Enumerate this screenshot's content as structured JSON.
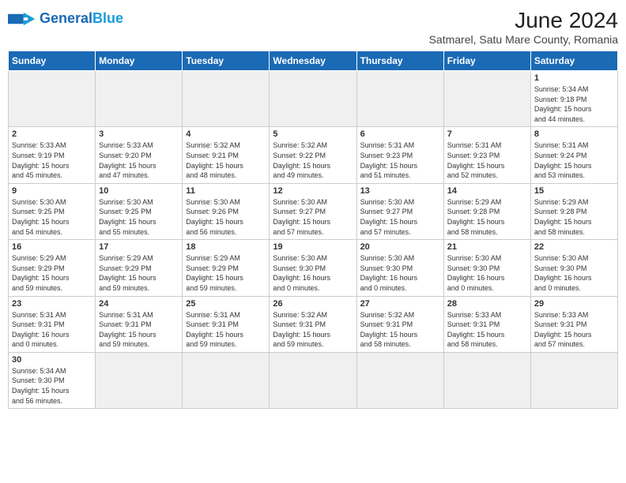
{
  "header": {
    "logo_general": "General",
    "logo_blue": "Blue",
    "month_title": "June 2024",
    "location": "Satmarel, Satu Mare County, Romania"
  },
  "weekdays": [
    "Sunday",
    "Monday",
    "Tuesday",
    "Wednesday",
    "Thursday",
    "Friday",
    "Saturday"
  ],
  "days": [
    {
      "date": null,
      "empty": true
    },
    {
      "date": null,
      "empty": true
    },
    {
      "date": null,
      "empty": true
    },
    {
      "date": null,
      "empty": true
    },
    {
      "date": null,
      "empty": true
    },
    {
      "date": null,
      "empty": true
    },
    {
      "date": "1",
      "info": "Sunrise: 5:34 AM\nSunset: 9:18 PM\nDaylight: 15 hours\nand 44 minutes."
    },
    {
      "date": "2",
      "info": "Sunrise: 5:33 AM\nSunset: 9:19 PM\nDaylight: 15 hours\nand 45 minutes."
    },
    {
      "date": "3",
      "info": "Sunrise: 5:33 AM\nSunset: 9:20 PM\nDaylight: 15 hours\nand 47 minutes."
    },
    {
      "date": "4",
      "info": "Sunrise: 5:32 AM\nSunset: 9:21 PM\nDaylight: 15 hours\nand 48 minutes."
    },
    {
      "date": "5",
      "info": "Sunrise: 5:32 AM\nSunset: 9:22 PM\nDaylight: 15 hours\nand 49 minutes."
    },
    {
      "date": "6",
      "info": "Sunrise: 5:31 AM\nSunset: 9:23 PM\nDaylight: 15 hours\nand 51 minutes."
    },
    {
      "date": "7",
      "info": "Sunrise: 5:31 AM\nSunset: 9:23 PM\nDaylight: 15 hours\nand 52 minutes."
    },
    {
      "date": "8",
      "info": "Sunrise: 5:31 AM\nSunset: 9:24 PM\nDaylight: 15 hours\nand 53 minutes."
    },
    {
      "date": "9",
      "info": "Sunrise: 5:30 AM\nSunset: 9:25 PM\nDaylight: 15 hours\nand 54 minutes."
    },
    {
      "date": "10",
      "info": "Sunrise: 5:30 AM\nSunset: 9:25 PM\nDaylight: 15 hours\nand 55 minutes."
    },
    {
      "date": "11",
      "info": "Sunrise: 5:30 AM\nSunset: 9:26 PM\nDaylight: 15 hours\nand 56 minutes."
    },
    {
      "date": "12",
      "info": "Sunrise: 5:30 AM\nSunset: 9:27 PM\nDaylight: 15 hours\nand 57 minutes."
    },
    {
      "date": "13",
      "info": "Sunrise: 5:30 AM\nSunset: 9:27 PM\nDaylight: 15 hours\nand 57 minutes."
    },
    {
      "date": "14",
      "info": "Sunrise: 5:29 AM\nSunset: 9:28 PM\nDaylight: 15 hours\nand 58 minutes."
    },
    {
      "date": "15",
      "info": "Sunrise: 5:29 AM\nSunset: 9:28 PM\nDaylight: 15 hours\nand 58 minutes."
    },
    {
      "date": "16",
      "info": "Sunrise: 5:29 AM\nSunset: 9:29 PM\nDaylight: 15 hours\nand 59 minutes."
    },
    {
      "date": "17",
      "info": "Sunrise: 5:29 AM\nSunset: 9:29 PM\nDaylight: 15 hours\nand 59 minutes."
    },
    {
      "date": "18",
      "info": "Sunrise: 5:29 AM\nSunset: 9:29 PM\nDaylight: 15 hours\nand 59 minutes."
    },
    {
      "date": "19",
      "info": "Sunrise: 5:30 AM\nSunset: 9:30 PM\nDaylight: 16 hours\nand 0 minutes."
    },
    {
      "date": "20",
      "info": "Sunrise: 5:30 AM\nSunset: 9:30 PM\nDaylight: 16 hours\nand 0 minutes."
    },
    {
      "date": "21",
      "info": "Sunrise: 5:30 AM\nSunset: 9:30 PM\nDaylight: 16 hours\nand 0 minutes."
    },
    {
      "date": "22",
      "info": "Sunrise: 5:30 AM\nSunset: 9:30 PM\nDaylight: 16 hours\nand 0 minutes."
    },
    {
      "date": "23",
      "info": "Sunrise: 5:31 AM\nSunset: 9:31 PM\nDaylight: 16 hours\nand 0 minutes."
    },
    {
      "date": "24",
      "info": "Sunrise: 5:31 AM\nSunset: 9:31 PM\nDaylight: 15 hours\nand 59 minutes."
    },
    {
      "date": "25",
      "info": "Sunrise: 5:31 AM\nSunset: 9:31 PM\nDaylight: 15 hours\nand 59 minutes."
    },
    {
      "date": "26",
      "info": "Sunrise: 5:32 AM\nSunset: 9:31 PM\nDaylight: 15 hours\nand 59 minutes."
    },
    {
      "date": "27",
      "info": "Sunrise: 5:32 AM\nSunset: 9:31 PM\nDaylight: 15 hours\nand 58 minutes."
    },
    {
      "date": "28",
      "info": "Sunrise: 5:33 AM\nSunset: 9:31 PM\nDaylight: 15 hours\nand 58 minutes."
    },
    {
      "date": "29",
      "info": "Sunrise: 5:33 AM\nSunset: 9:31 PM\nDaylight: 15 hours\nand 57 minutes."
    },
    {
      "date": "30",
      "info": "Sunrise: 5:34 AM\nSunset: 9:30 PM\nDaylight: 15 hours\nand 56 minutes."
    },
    {
      "date": null,
      "empty": true
    },
    {
      "date": null,
      "empty": true
    },
    {
      "date": null,
      "empty": true
    },
    {
      "date": null,
      "empty": true
    },
    {
      "date": null,
      "empty": true
    },
    {
      "date": null,
      "empty": true
    }
  ]
}
